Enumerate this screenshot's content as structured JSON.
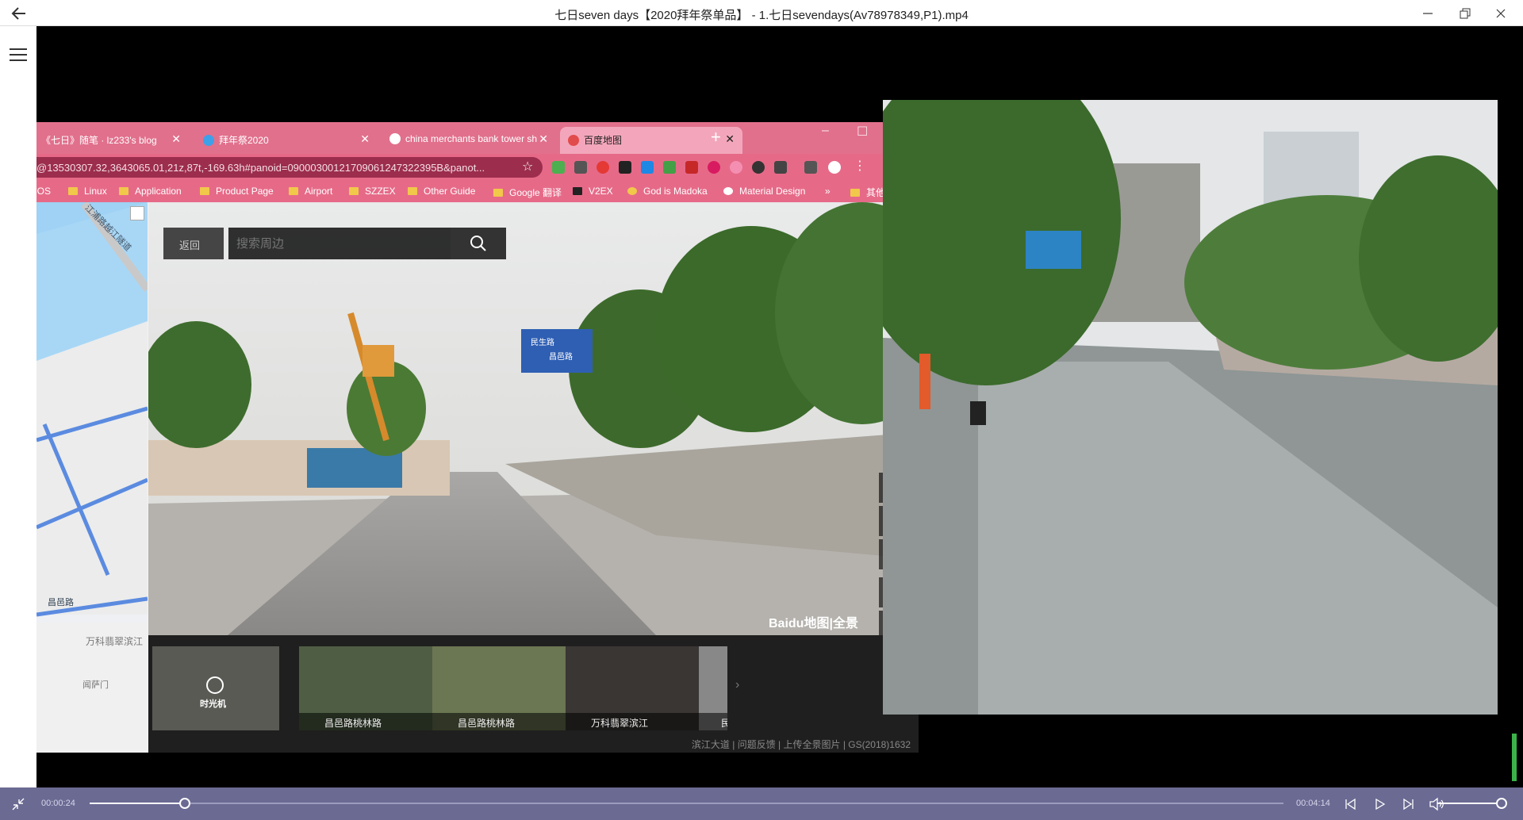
{
  "window": {
    "title": "七日seven days【2020拜年祭单品】 - 1.七日sevendays(Av78978349,P1).mp4"
  },
  "browser": {
    "tabs": [
      {
        "label": "《七日》随笔 · lz233's blog",
        "active": false
      },
      {
        "label": "拜年祭2020",
        "active": false
      },
      {
        "label": "china merchants bank tower sh",
        "active": false
      },
      {
        "label": "百度地图",
        "active": true
      }
    ],
    "url": "@13530307.32,3643065.01,21z,87t,-169.63h#panoid=09000300121709061247322395B&panot...",
    "bookmarks": [
      "iOS",
      "Linux",
      "Application",
      "Product Page",
      "Airport",
      "SZZEX",
      "Other Guide",
      "Google 翻译",
      "V2EX",
      "God is Madoka",
      "Material Design",
      "»",
      "其他书签"
    ]
  },
  "map": {
    "search_back": "返回",
    "search_placeholder": "搜索周边",
    "labels": [
      "江浦路越江隧道",
      "昌邑路",
      "万科翡翠滨江",
      "闻萨门"
    ],
    "logo": "Baidu地图|全景",
    "timemachine_label": "时光机",
    "thumbs": [
      "昌邑路桃林路",
      "昌邑路桃林路",
      "万科翡翠滨江",
      "民"
    ],
    "footer": "滨江大道  |  问题反馈  |  上传全景图片  |  GS(2018)1632",
    "sign_line1": "民生路",
    "sign_line2": "昌邑路"
  },
  "player": {
    "current_time": "00:00:24",
    "total_time": "00:04:14",
    "progress": 0.08,
    "volume": 0.9
  }
}
